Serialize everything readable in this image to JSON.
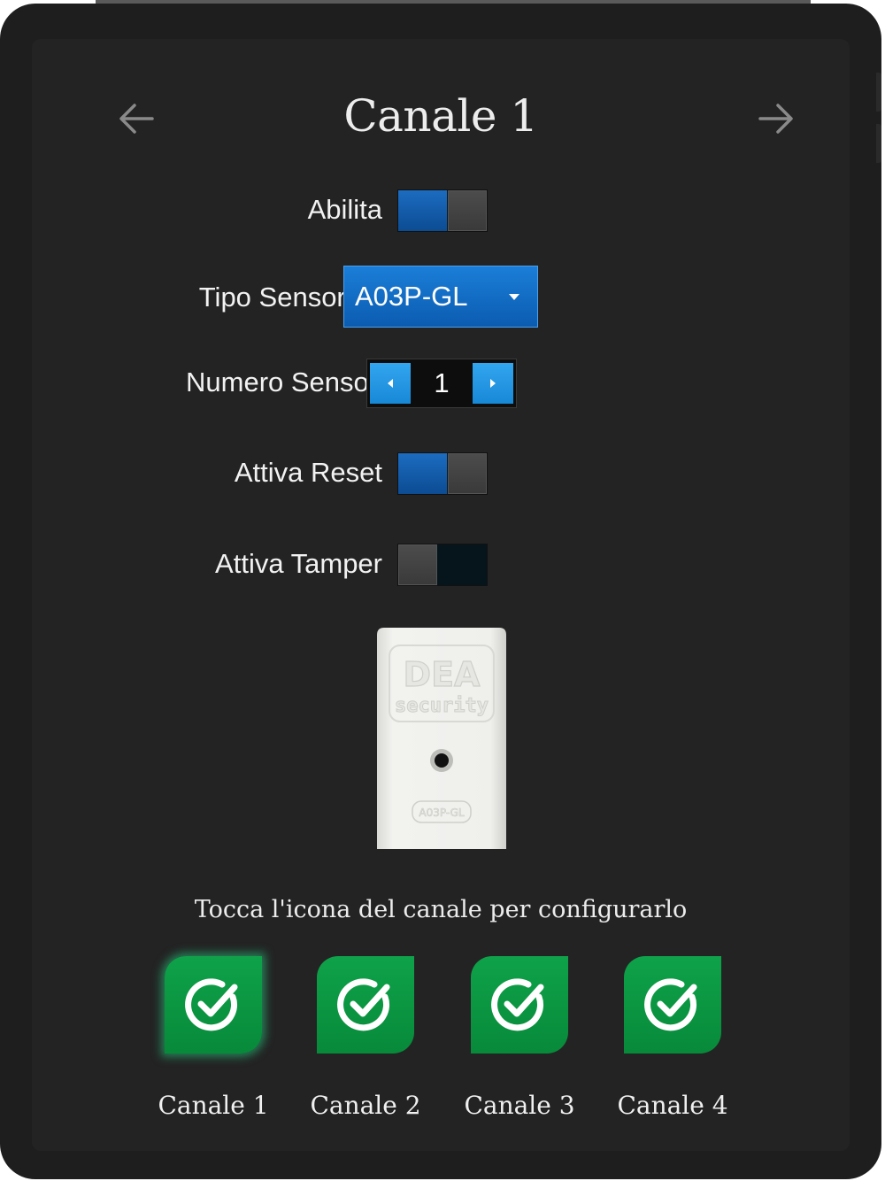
{
  "header": {
    "title": "Canale 1",
    "back_icon": "arrow-left-icon",
    "forward_icon": "arrow-right-icon"
  },
  "settings": {
    "enable_label": "Abilita",
    "enable_on": true,
    "sensor_type_label": "Tipo Sensore",
    "sensor_type_value": "A03P-GL",
    "sensor_count_label": "Numero Sensori",
    "sensor_count_value": "1",
    "reset_label": "Attiva Reset",
    "reset_on": true,
    "tamper_label": "Attiva Tamper",
    "tamper_on": false
  },
  "sensor_image": {
    "brand_text": "DEA",
    "brand_sub": "security",
    "model_text": "A03P-GL"
  },
  "footer": {
    "hint": "Tocca l'icona del canale per configurarlo",
    "channels": [
      {
        "label": "Canale 1",
        "icon": "check-circle-icon",
        "selected": true
      },
      {
        "label": "Canale 2",
        "icon": "check-circle-icon",
        "selected": false
      },
      {
        "label": "Canale 3",
        "icon": "check-circle-icon",
        "selected": false
      },
      {
        "label": "Canale 4",
        "icon": "check-circle-icon",
        "selected": false
      }
    ]
  },
  "colors": {
    "toggle_on": "#1c6cc0",
    "select_bg": "#0b5cb0",
    "stepper_btn": "#1788d6",
    "channel_green": "#0fa24a",
    "background": "#232323"
  }
}
